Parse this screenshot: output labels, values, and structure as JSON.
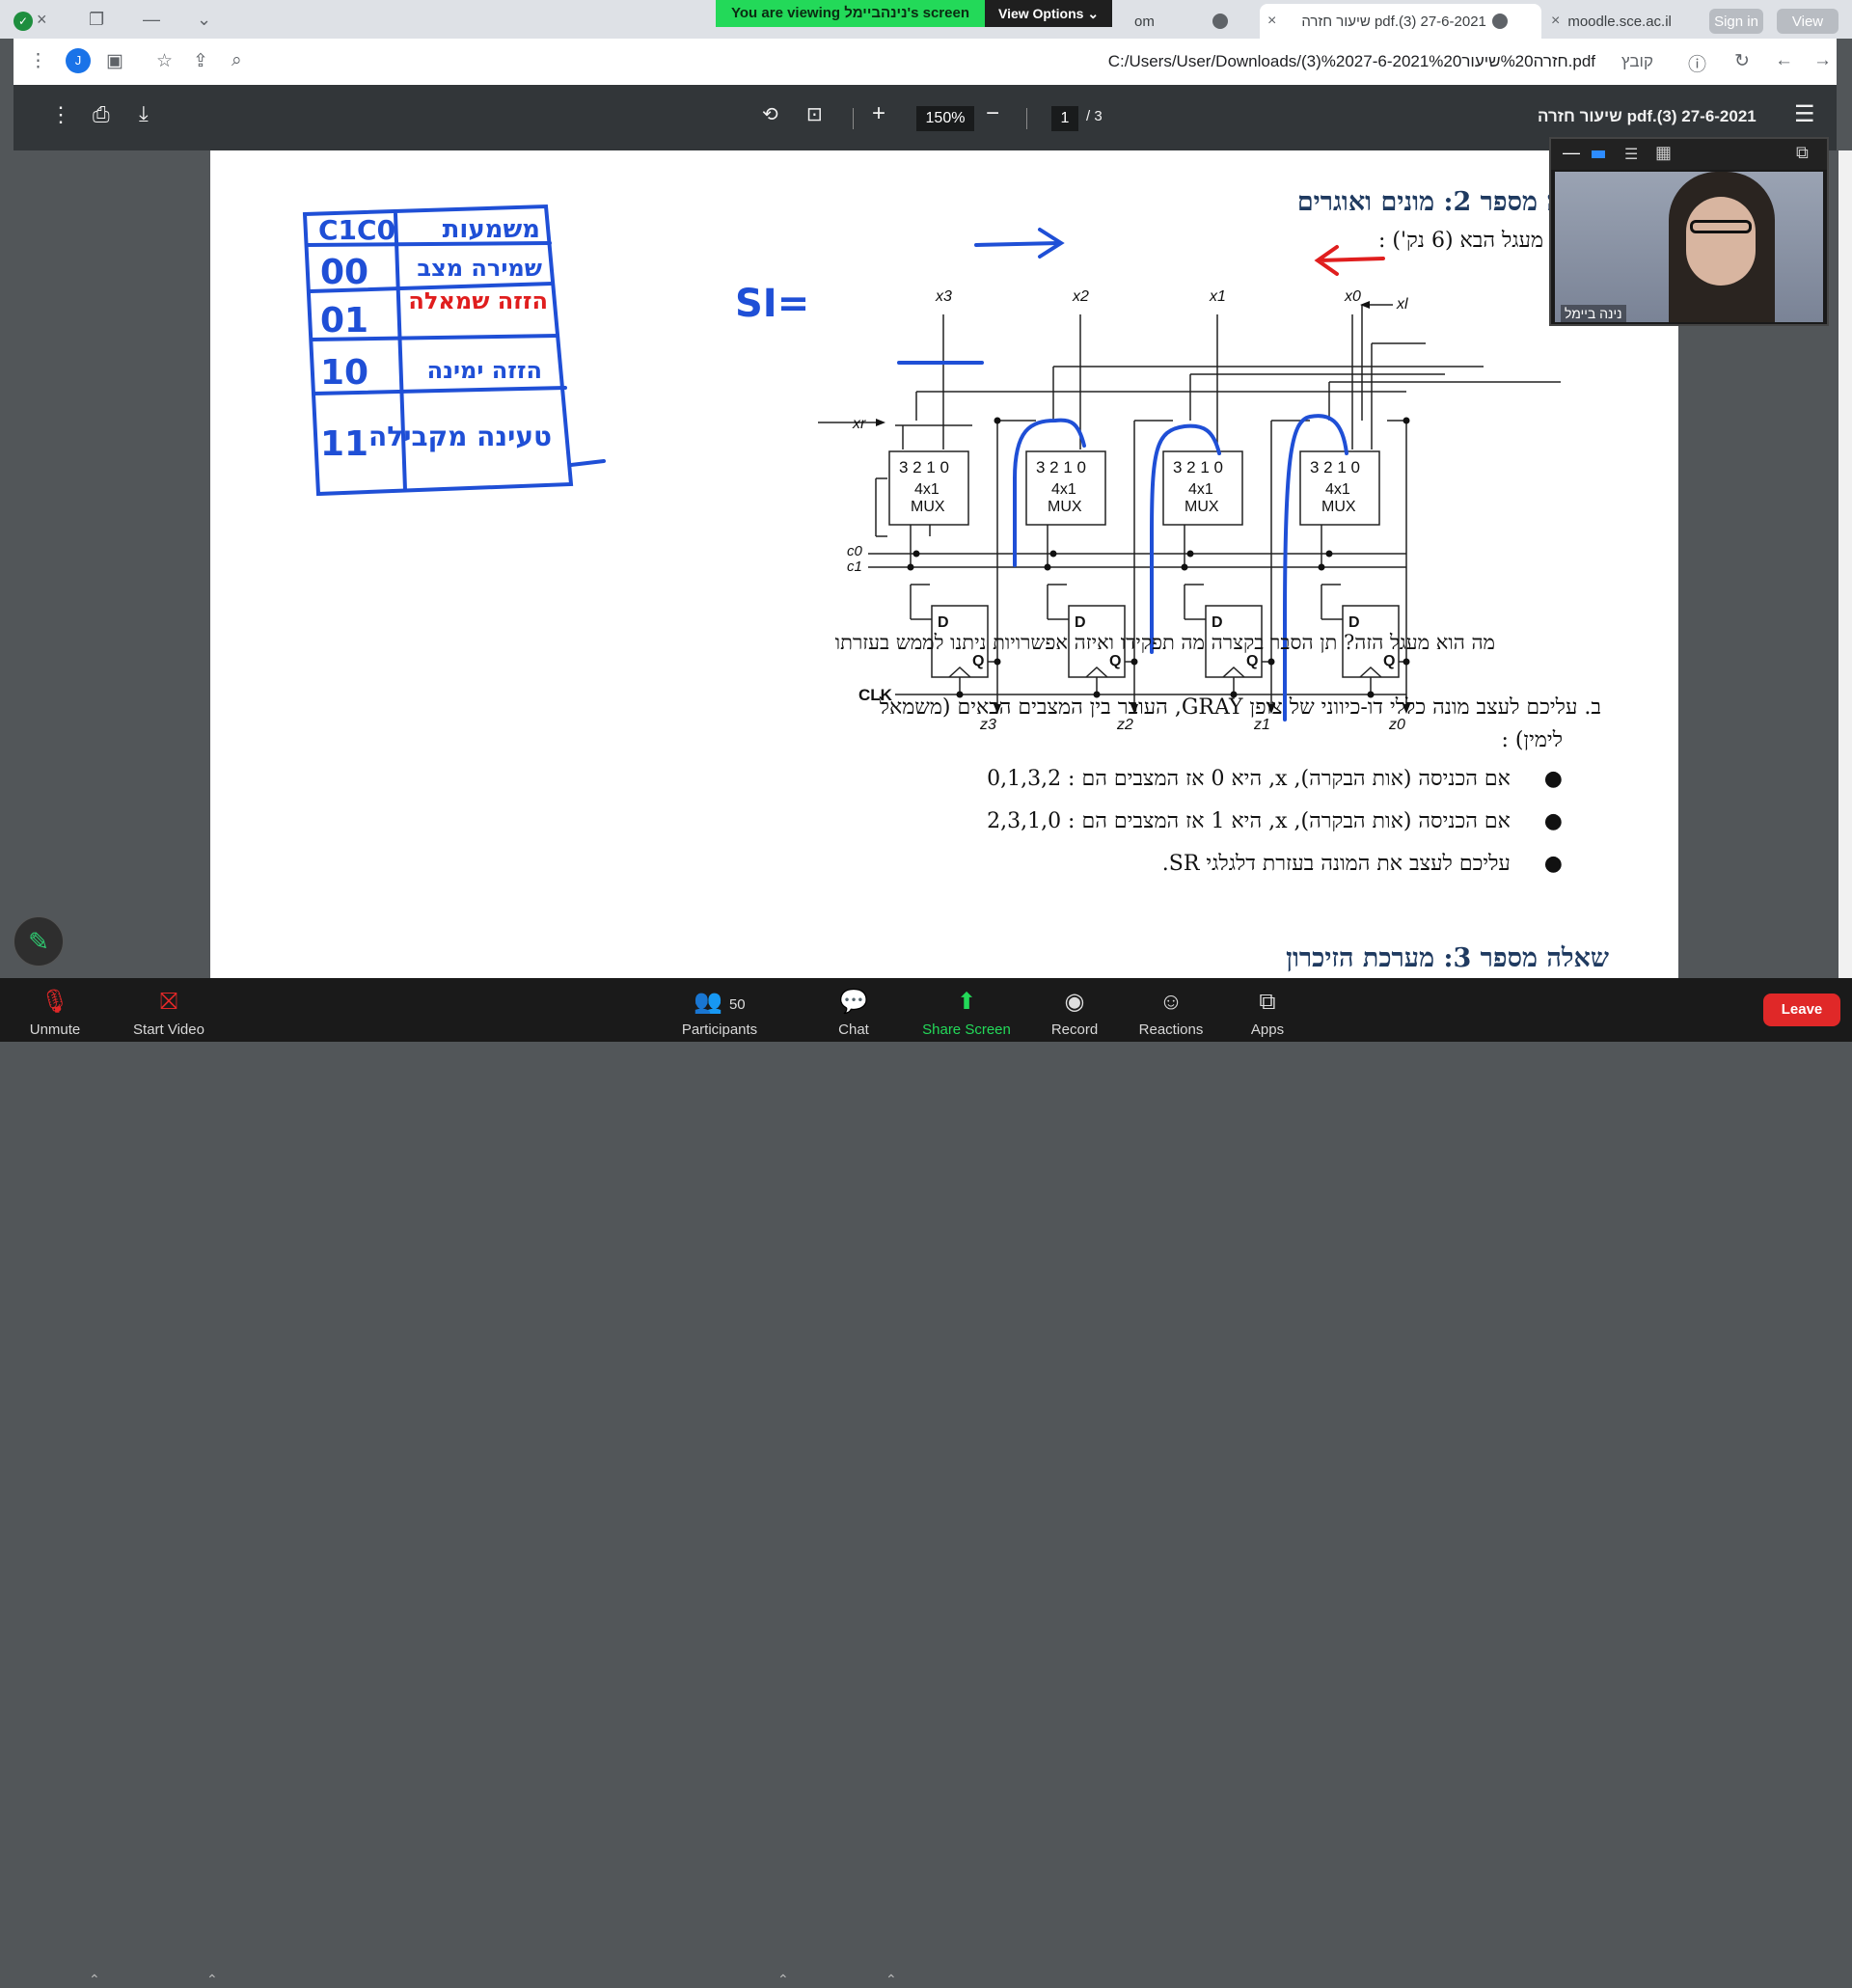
{
  "zoom_banner": {
    "text": "You are viewing נינהביימל's screen",
    "view_options": "View Options"
  },
  "tabs": [
    {
      "label": "moodle.sce.ac.il"
    },
    {
      "label": "pdf.(3) 27-6-2021 שיעור חזרה"
    },
    {
      "label": "om"
    }
  ],
  "top_buttons": {
    "sign_in": "Sign in",
    "view": "View"
  },
  "address": {
    "scheme": "קובץ",
    "url": "C:/Users/User/Downloads/(3)%2027-6-2021%20חזרה%20שיעור.pdf",
    "profile": "J"
  },
  "pdf_toolbar": {
    "title": "pdf.(3) 27-6-2021 שיעור חזרה",
    "zoom": "150%",
    "page": "1",
    "page_total": "/  3"
  },
  "document": {
    "q2_title": "שאלה מספר 2: מונים ואוגרים",
    "q2a": "א.    נתון מעגל הבא (6 נק') :",
    "q2a_question": "מה הוא מעגל הזה? תן הסבר בקצרה מה תפקידו ואיזה אפשרויות ניתנו לממש בעזרתו",
    "q2b_line1": "ב.    עליכם לעצב מונה כללי דו-כיווני של צופן GRAY, העובר בין המצבים הבאים (משמאל",
    "q2b_line2": "לימין) :",
    "bullet1": "אם הכניסה (אות הבקרה), x, היא 0 אז המצבים הם : 0,1,3,2",
    "bullet2": "אם הכניסה (אות הבקרה), x, היא  1 אז המצבים הם : 2,3,1,0",
    "bullet3": "עליכם לעצב את המונה בעזרת דלגלגי SR.",
    "q3_title": "שאלה מספר 3: מערכת הזיכרון",
    "circuit": {
      "inputs": [
        "x3",
        "x2",
        "x1",
        "x0"
      ],
      "xr": "xr",
      "xl": "xl",
      "mux_sel": "3  2  1  0",
      "mux_label1": "4x1",
      "mux_label2": "MUX",
      "c0": "c0",
      "c1": "c1",
      "d": "D",
      "q": "Q",
      "clk": "CLK",
      "outputs": [
        "z3",
        "z2",
        "z1",
        "z0"
      ]
    },
    "handwriting": {
      "header_left": "C1C0",
      "header_right": "משמעות",
      "row_labels": [
        "00",
        "01",
        "10",
        "11"
      ],
      "row_texts": [
        "שמירה מצב",
        "הזזה שמאלה",
        "הזזה ימינה",
        "טעינה מקבילה"
      ],
      "si_label": "SI="
    }
  },
  "video": {
    "name": "נינה ביימל"
  },
  "zoom_bar": {
    "unmute": "Unmute",
    "start_video": "Start Video",
    "participants": "Participants",
    "participants_count": "50",
    "chat": "Chat",
    "share": "Share Screen",
    "record": "Record",
    "reactions": "Reactions",
    "apps": "Apps",
    "leave": "Leave"
  }
}
